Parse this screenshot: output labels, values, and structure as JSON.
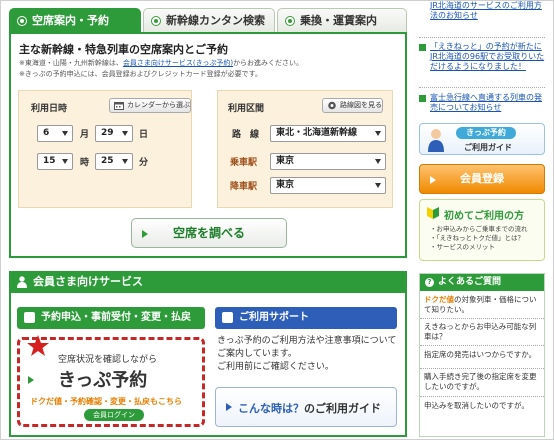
{
  "tabs": [
    {
      "label": "空席案内・予約",
      "active": true
    },
    {
      "label": "新幹線カンタン検索",
      "active": false
    },
    {
      "label": "乗換・運賃案内",
      "active": false
    }
  ],
  "search_panel": {
    "title": "主な新幹線・特急列車の空席案内とご予約",
    "note1_prefix": "※東海道・山陽・九州新幹線は、",
    "note1_link": "会員さま向けサービス(きっぷ予約)",
    "note1_suffix": "からお進みください。",
    "note2": "※きっぷの予約申込には、会員登録およびクレジットカード登録が必要です。",
    "datetime_label": "利用日時",
    "calendar_button": "カレンダーから選ぶ",
    "month": "6",
    "month_unit": "月",
    "day": "29",
    "day_unit": "日",
    "hour": "15",
    "hour_unit": "時",
    "minute": "25",
    "minute_unit": "分",
    "section_label": "利用区間",
    "route_map_button": "路線図を見る",
    "line_label": "路　線",
    "line_value": "東北・北海道新幹線",
    "board_label": "乗車駅",
    "board_value": "東京",
    "alight_label": "降車駅",
    "alight_value": "東京",
    "search_button": "空席を調べる"
  },
  "member_panel": {
    "title": "会員さま向けサービス",
    "reservation_bar": "予約申込・事前受付・変更・払戻",
    "support_bar": "ご利用サポート",
    "kippu_sub": "空席状況を確認しながら",
    "kippu_title": "きっぷ予約",
    "kippu_note": "ドクだ値・予約確認・変更・払戻もこちら",
    "kippu_login": "会員ログイン",
    "support_text1": "きっぷ予約のご利用方法や注意事項についてご案内しています。",
    "support_text2": "ご利用前にご確認ください。",
    "guide_pre": "こんな時は？",
    "guide_post": "のご利用ガイド"
  },
  "sidebar": {
    "news": [
      "「えきねっと」の予約が新たにJR北海道の96駅でお受取りいただけるようになりました！",
      "富士急行線へ直通する列車の発売についてお知らせ"
    ],
    "news_top_partial": "JR北海道のサービスのご利用方法のお知らせ",
    "guide_banner_title": "きっぷ予約",
    "guide_banner_sub": "ご利用ガイド",
    "register_button": "会員登録",
    "first_time_title": "初めてご利用の方",
    "first_time_lines": [
      "・お申込みからご乗車までの流れ",
      "・「えきねっとトクだ値」とは？",
      "・サービスのメリット"
    ],
    "faq_title": "よくあるご質問",
    "faq": [
      {
        "strong": "ドクだ値",
        "text": "の対象列車・価格について知りたい。"
      },
      {
        "strong": "",
        "text": "えきねっとからお申込み可能な列車は？"
      },
      {
        "strong": "",
        "text": "指定席の発売はいつからですか。"
      },
      {
        "strong": "",
        "text": "購入手続き完了後の指定席を変更したいのですが。"
      },
      {
        "strong": "",
        "text": "申込みを取消したいのですが。"
      }
    ]
  }
}
